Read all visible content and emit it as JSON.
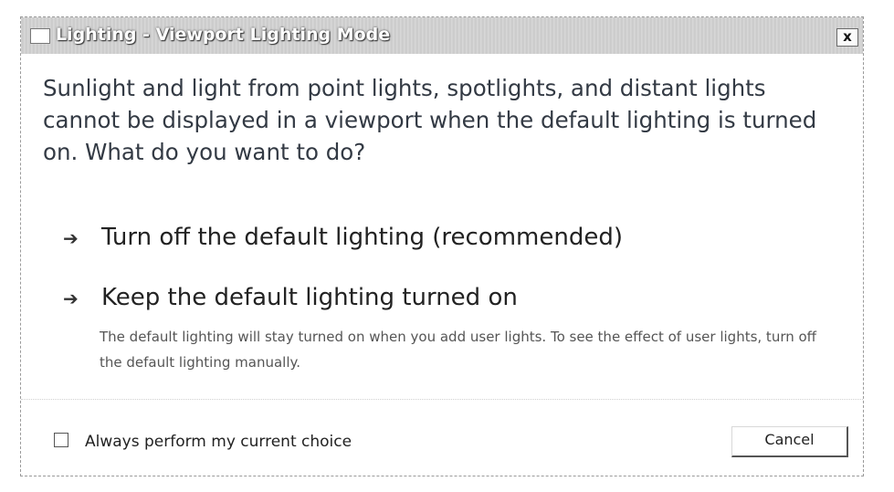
{
  "window": {
    "title": "Lighting - Viewport Lighting Mode",
    "close_glyph": "x"
  },
  "main_instruction": "Sunlight and light from point lights, spotlights, and distant lights cannot be displayed in a viewport when the default lighting is turned on. What do you want to do?",
  "commands": [
    {
      "arrow": "➔",
      "label": "Turn off the default lighting (recommended)",
      "note": ""
    },
    {
      "arrow": "➔",
      "label": "Keep the default lighting turned on",
      "note": "The default lighting will stay turned on when you add user lights. To see the effect of user lights, turn off the default lighting manually."
    }
  ],
  "footer": {
    "checkbox_checked": false,
    "checkbox_label": "Always perform my current choice",
    "cancel_label": "Cancel"
  },
  "icons": {
    "app_icon": "window-icon",
    "command_arrow": "arrow-right-icon"
  }
}
